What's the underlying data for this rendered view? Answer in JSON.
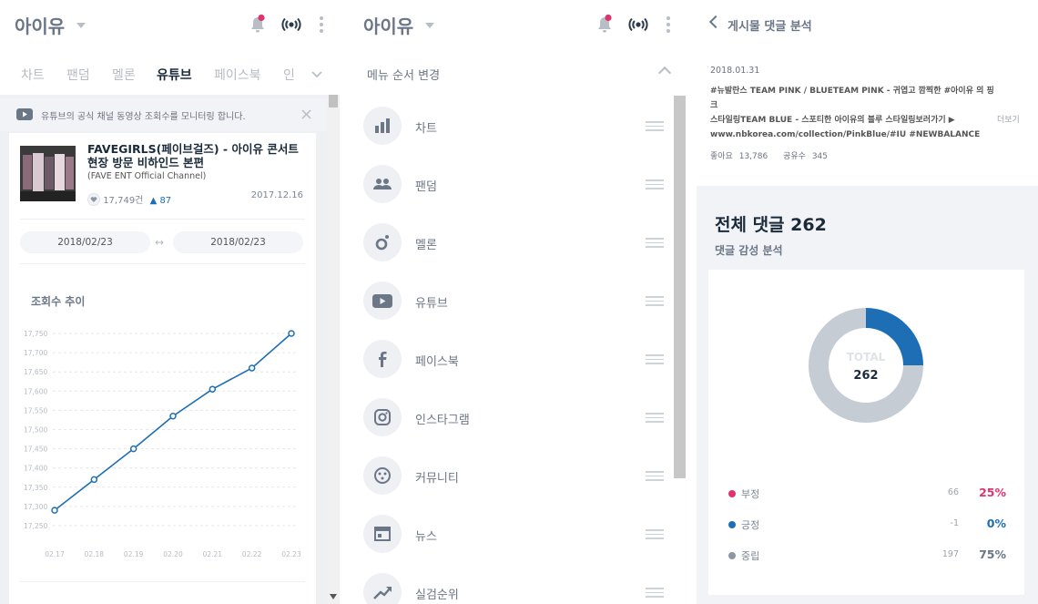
{
  "screen1": {
    "header": {
      "title": "아이유"
    },
    "tabs": [
      {
        "label": "차트",
        "active": false
      },
      {
        "label": "팬덤",
        "active": false
      },
      {
        "label": "멜론",
        "active": false
      },
      {
        "label": "유튜브",
        "active": true
      },
      {
        "label": "페이스북",
        "active": false
      },
      {
        "label": "인",
        "active": false
      }
    ],
    "notice": {
      "text": "유튜브의 공식 채널 동영상 조회수를 모니터링 합니다."
    },
    "video": {
      "title": "FAVEGIRLS(페이브걸즈) - 아이유 콘서트 현장 방문 비하인드 본편",
      "channel": "(FAVE ENT Official Channel)",
      "views": "17,749건",
      "delta": "▲ 87",
      "date": "2017.12.16"
    },
    "date_range": {
      "start": "2018/02/23",
      "end": "2018/02/23",
      "sep": "↔"
    },
    "chart_title": "조회수 추이"
  },
  "chart_data": {
    "type": "line",
    "title": "조회수 추이",
    "x": [
      "02.17",
      "02.18",
      "02.19",
      "02.20",
      "02.21",
      "02.22",
      "02.23"
    ],
    "series": [
      {
        "values": [
          17290,
          17370,
          17450,
          17535,
          17605,
          17660,
          17750
        ]
      }
    ],
    "y_ticks": [
      "17,750",
      "17,700",
      "17,650",
      "17,600",
      "17,550",
      "17,500",
      "17,450",
      "17,400",
      "17,350",
      "17,300",
      "17,250"
    ],
    "ylim": [
      17250,
      17750
    ],
    "grid": true,
    "color": "#1e6eb5"
  },
  "screen2": {
    "header": {
      "title": "아이유"
    },
    "menu_header": "메뉴 순서 변경",
    "items": [
      {
        "label": "차트",
        "icon": "bar-chart-icon"
      },
      {
        "label": "팬덤",
        "icon": "people-icon"
      },
      {
        "label": "멜론",
        "icon": "melon-icon"
      },
      {
        "label": "유튜브",
        "icon": "youtube-icon"
      },
      {
        "label": "페이스북",
        "icon": "facebook-icon"
      },
      {
        "label": "인스타그램",
        "icon": "instagram-icon"
      },
      {
        "label": "커뮤니티",
        "icon": "community-icon"
      },
      {
        "label": "뉴스",
        "icon": "news-icon"
      },
      {
        "label": "실검순위",
        "icon": "trend-icon"
      }
    ]
  },
  "screen3": {
    "header": {
      "title": "게시물 댓글 분석"
    },
    "post": {
      "date": "2018.01.31",
      "text_lines": [
        "#뉴발란스 TEAM PINK / BLUETEAM PINK - 귀엽고 깜찍한 #아이유 의 핑크",
        "스타일링TEAM BLUE - 스포티한 아이유의 블루 스타일링보러가기 ▶",
        "www.nbkorea.com/collection/PinkBlue/#IU #NEWBALANCE"
      ],
      "more": "더보기",
      "likes_label": "좋아요",
      "likes": "13,786",
      "shares_label": "공유수",
      "shares": "345"
    },
    "total_comments": "전체 댓글 262",
    "sentiment_title": "댓글 감성 분석",
    "donut": {
      "label": "TOTAL",
      "value": "262"
    },
    "sentiments": [
      {
        "name": "부정",
        "count": "66",
        "pct": "25%",
        "color": "#e0336c",
        "fraction": 0.25
      },
      {
        "name": "긍정",
        "count": "-1",
        "pct": "0%",
        "color": "#1e6eb5",
        "fraction": 0.0
      },
      {
        "name": "중립",
        "count": "197",
        "pct": "75%",
        "color": "#8d97a3",
        "fraction": 0.75
      }
    ]
  }
}
